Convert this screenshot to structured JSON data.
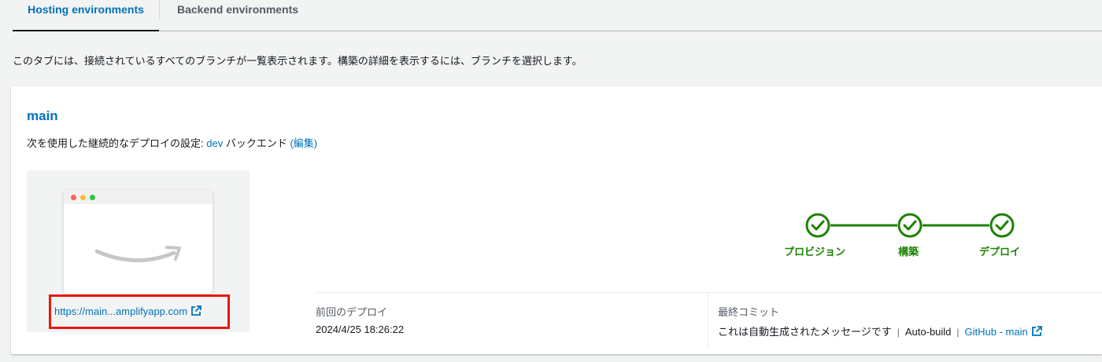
{
  "tabs": [
    {
      "label": "Hosting environments",
      "active": true
    },
    {
      "label": "Backend environments",
      "active": false
    }
  ],
  "description": "このタブには、接続されているすべてのブランチが一覧表示されます。構築の詳細を表示するには、ブランチを選択します。",
  "branch": {
    "name": "main",
    "cd_prefix": "次を使用した継続的なデプロイの設定: ",
    "backend_env": "dev",
    "backend_suffix": " バックエンド ",
    "edit_label": "(編集)",
    "url": "https://main...amplifyapp.com"
  },
  "pipeline": {
    "steps": [
      "プロビジョン",
      "構築",
      "デプロイ"
    ],
    "status": "success",
    "color": "#1d8102"
  },
  "last_deploy": {
    "label": "前回のデプロイ",
    "value": "2024/4/25 18:26:22"
  },
  "last_commit": {
    "label": "最終コミット",
    "message": "これは自動生成されたメッセージです",
    "type": "Auto-build",
    "repo_link": "GitHub - main"
  },
  "colors": {
    "accent": "#0073bb",
    "success": "#1d8102",
    "highlight": "#e8180c"
  }
}
